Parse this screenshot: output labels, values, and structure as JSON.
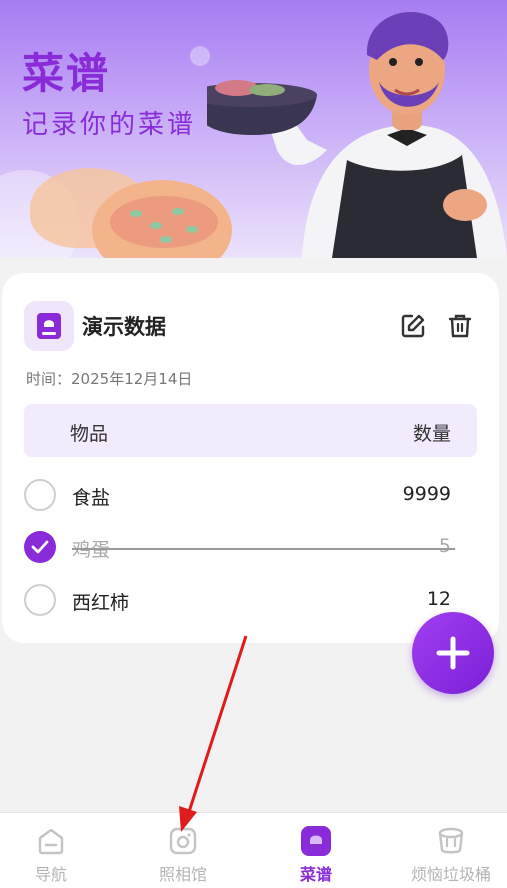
{
  "banner": {
    "title": "菜谱",
    "subtitle": "记录你的菜谱"
  },
  "recipe": {
    "name": "演示数据",
    "time_label": "时间：",
    "date": "2025年12月14日",
    "columns": {
      "item": "物品",
      "quantity": "数量"
    },
    "items": [
      {
        "name": "食盐",
        "quantity": "9999",
        "checked": false
      },
      {
        "name": "鸡蛋",
        "quantity": "5",
        "checked": true
      },
      {
        "name": "西红柿",
        "quantity": "12",
        "checked": false
      }
    ]
  },
  "icons": {
    "recipe": "recipe-book-icon",
    "edit": "edit-icon",
    "delete": "trash-icon",
    "add": "plus-icon"
  },
  "bottom_nav": {
    "items": [
      {
        "label": "导航",
        "icon": "home-icon",
        "active": false
      },
      {
        "label": "照相馆",
        "icon": "camera-icon",
        "active": false
      },
      {
        "label": "菜谱",
        "icon": "recipe-icon",
        "active": true
      },
      {
        "label": "烦恼垃圾桶",
        "icon": "bin-icon",
        "active": false
      }
    ]
  },
  "colors": {
    "accent": "#8a2bd9",
    "accent_light": "#f1ebfd",
    "annotation_arrow": "#e01b1b"
  }
}
